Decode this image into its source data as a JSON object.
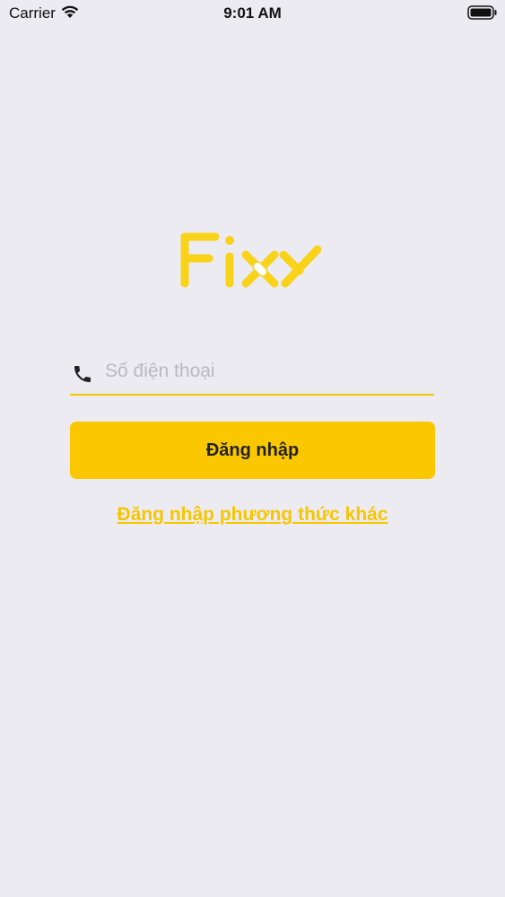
{
  "status_bar": {
    "carrier": "Carrier",
    "time": "9:01 AM",
    "wifi_icon": "wifi-icon",
    "battery_icon": "battery-icon"
  },
  "logo": {
    "text": "Fixy",
    "color": "#F9D21A"
  },
  "phone_field": {
    "icon": "phone-icon",
    "value": "",
    "placeholder": "Số điện thoại",
    "underline_color": "#F6C700"
  },
  "login_button": {
    "label": "Đăng nhập",
    "color": "#FBC800"
  },
  "other_method_link": {
    "label": "Đăng nhập phương thức khác",
    "color": "#F6C600"
  },
  "background_color": "#ECEBF1"
}
